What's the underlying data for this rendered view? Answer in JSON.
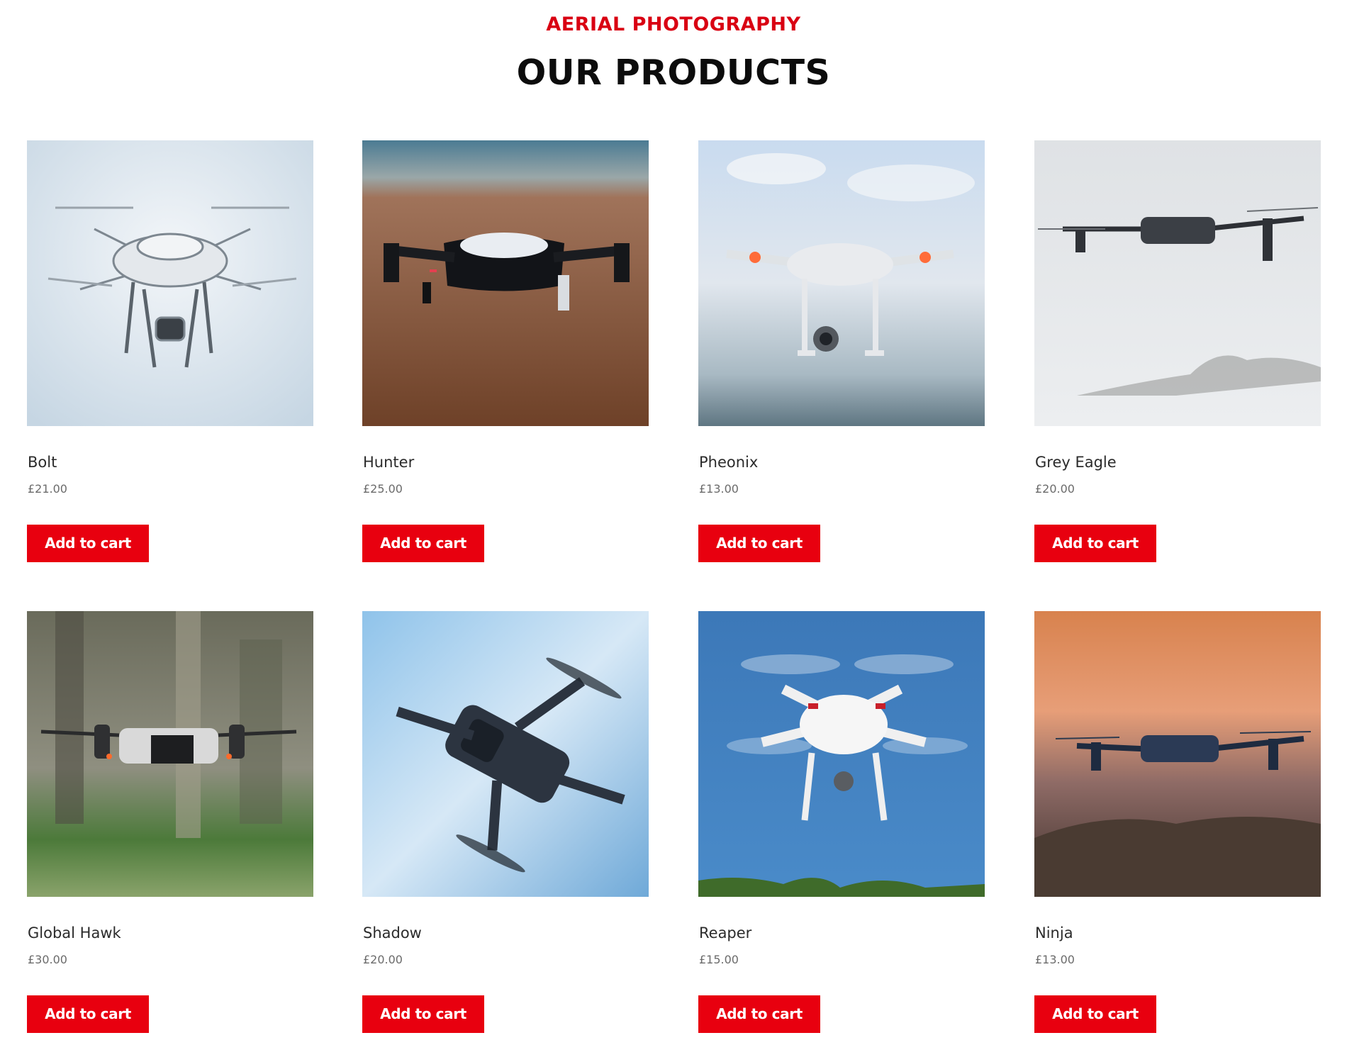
{
  "section": {
    "eyebrow": "AERIAL PHOTOGRAPHY",
    "title": "OUR PRODUCTS"
  },
  "colors": {
    "accent": "#e8000f",
    "eyebrow": "#d90012",
    "title": "#0c0c0c"
  },
  "products": [
    {
      "name": "Bolt",
      "price": "£21.00",
      "button": "Add to cart",
      "image": "white-quadcopter-pale-sky"
    },
    {
      "name": "Hunter",
      "price": "£25.00",
      "button": "Add to cart",
      "image": "black-white-drone-over-beach"
    },
    {
      "name": "Pheonix",
      "price": "£13.00",
      "button": "Add to cart",
      "image": "white-quadcopter-cloudy-sky"
    },
    {
      "name": "Grey Eagle",
      "price": "£20.00",
      "button": "Add to cart",
      "image": "dark-drone-grey-sky"
    },
    {
      "name": "Global Hawk",
      "price": "£30.00",
      "button": "Add to cart",
      "image": "small-drone-forest"
    },
    {
      "name": "Shadow",
      "price": "£20.00",
      "button": "Add to cart",
      "image": "dark-drone-blue-sky"
    },
    {
      "name": "Reaper",
      "price": "£15.00",
      "button": "Add to cart",
      "image": "white-quadcopter-blue-sky"
    },
    {
      "name": "Ninja",
      "price": "£13.00",
      "button": "Add to cart",
      "image": "dark-drone-sunset-sea"
    }
  ]
}
